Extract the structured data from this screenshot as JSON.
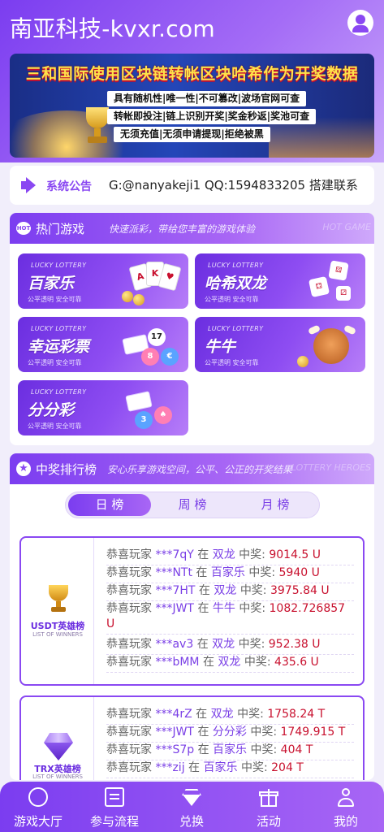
{
  "header": {
    "site_title": "南亚科技-kvxr.com",
    "user_icon": "user-circle-icon"
  },
  "banner": {
    "headline": "三和国际使用区块链转帐区块哈希作为开奖数据",
    "lines": [
      "具有随机性|唯一性|不可篡改|波场官网可查",
      "转帐即投注|链上识别开奖|奖金秒返|奖池可查",
      "无须充值|无须申请提现|拒绝被黑"
    ]
  },
  "notice": {
    "icon": "megaphone-icon",
    "label": "系统公告",
    "text": "G:@nanyakeji1 QQ:1594833205 搭建联系"
  },
  "hot_games": {
    "icon_text": "HOT",
    "title": "热门游戏",
    "subtitle": "快速派彩，带给您丰富的游戏体验",
    "watermark": "HOT GAME",
    "cards": [
      {
        "badge": "LUCKY LOTTERY",
        "name": "百家乐",
        "tag": "公平透明 安全可靠"
      },
      {
        "badge": "LUCKY LOTTERY",
        "name": "哈希双龙",
        "tag": "公平透明 安全可靠"
      },
      {
        "badge": "LUCKY LOTTERY",
        "name": "幸运彩票",
        "tag": "公平透明 安全可靠"
      },
      {
        "badge": "LUCKY LOTTERY",
        "name": "牛牛",
        "tag": "公平透明 安全可靠"
      },
      {
        "badge": "LUCKY LOTTERY",
        "name": "分分彩",
        "tag": "公平透明 安全可靠"
      }
    ]
  },
  "leaderboard": {
    "title": "中奖排行榜",
    "subtitle": "安心乐享游戏空间，公平、公正的开奖结果",
    "watermark": "LOTTERY HEROES",
    "tabs": [
      {
        "label": "日 榜",
        "active": true
      },
      {
        "label": "周 榜",
        "active": false
      },
      {
        "label": "月 榜",
        "active": false
      }
    ],
    "usdt": {
      "title": "USDT英雄榜",
      "sub": "LIST OF WINNERS",
      "rows": [
        {
          "prefix": "恭喜玩家",
          "nick": "***7qY",
          "zai": "在",
          "game": "双龙",
          "label": "中奖:",
          "amount": "9014.5 U"
        },
        {
          "prefix": "恭喜玩家",
          "nick": "***NTt",
          "zai": "在",
          "game": "百家乐",
          "label": "中奖:",
          "amount": "5940 U"
        },
        {
          "prefix": "恭喜玩家",
          "nick": "***7HT",
          "zai": "在",
          "game": "双龙",
          "label": "中奖:",
          "amount": "3975.84 U"
        },
        {
          "prefix": "恭喜玩家",
          "nick": "***JWT",
          "zai": "在",
          "game": "牛牛",
          "label": "中奖:",
          "amount": "1082.726857 U"
        },
        {
          "prefix": "恭喜玩家",
          "nick": "***av3",
          "zai": "在",
          "game": "双龙",
          "label": "中奖:",
          "amount": "952.38 U"
        },
        {
          "prefix": "恭喜玩家",
          "nick": "***bMM",
          "zai": "在",
          "game": "双龙",
          "label": "中奖:",
          "amount": "435.6 U"
        }
      ]
    },
    "trx": {
      "title": "TRX英雄榜",
      "sub": "LIST OF WINNERS",
      "rows": [
        {
          "prefix": "恭喜玩家",
          "nick": "***4rZ",
          "zai": "在",
          "game": "双龙",
          "label": "中奖:",
          "amount": "1758.24 T"
        },
        {
          "prefix": "恭喜玩家",
          "nick": "***JWT",
          "zai": "在",
          "game": "分分彩",
          "label": "中奖:",
          "amount": "1749.915 T"
        },
        {
          "prefix": "恭喜玩家",
          "nick": "***S7p",
          "zai": "在",
          "game": "百家乐",
          "label": "中奖:",
          "amount": "404 T"
        },
        {
          "prefix": "恭喜玩家",
          "nick": "***zij",
          "zai": "在",
          "game": "百家乐",
          "label": "中奖:",
          "amount": "204 T"
        }
      ]
    }
  },
  "bottom_nav": {
    "items": [
      {
        "label": "游戏大厅",
        "icon": "game-hall-icon"
      },
      {
        "label": "参与流程",
        "icon": "document-icon"
      },
      {
        "label": "兑换",
        "icon": "diamond-icon"
      },
      {
        "label": "活动",
        "icon": "gift-icon"
      },
      {
        "label": "我的",
        "icon": "profile-icon"
      }
    ]
  }
}
